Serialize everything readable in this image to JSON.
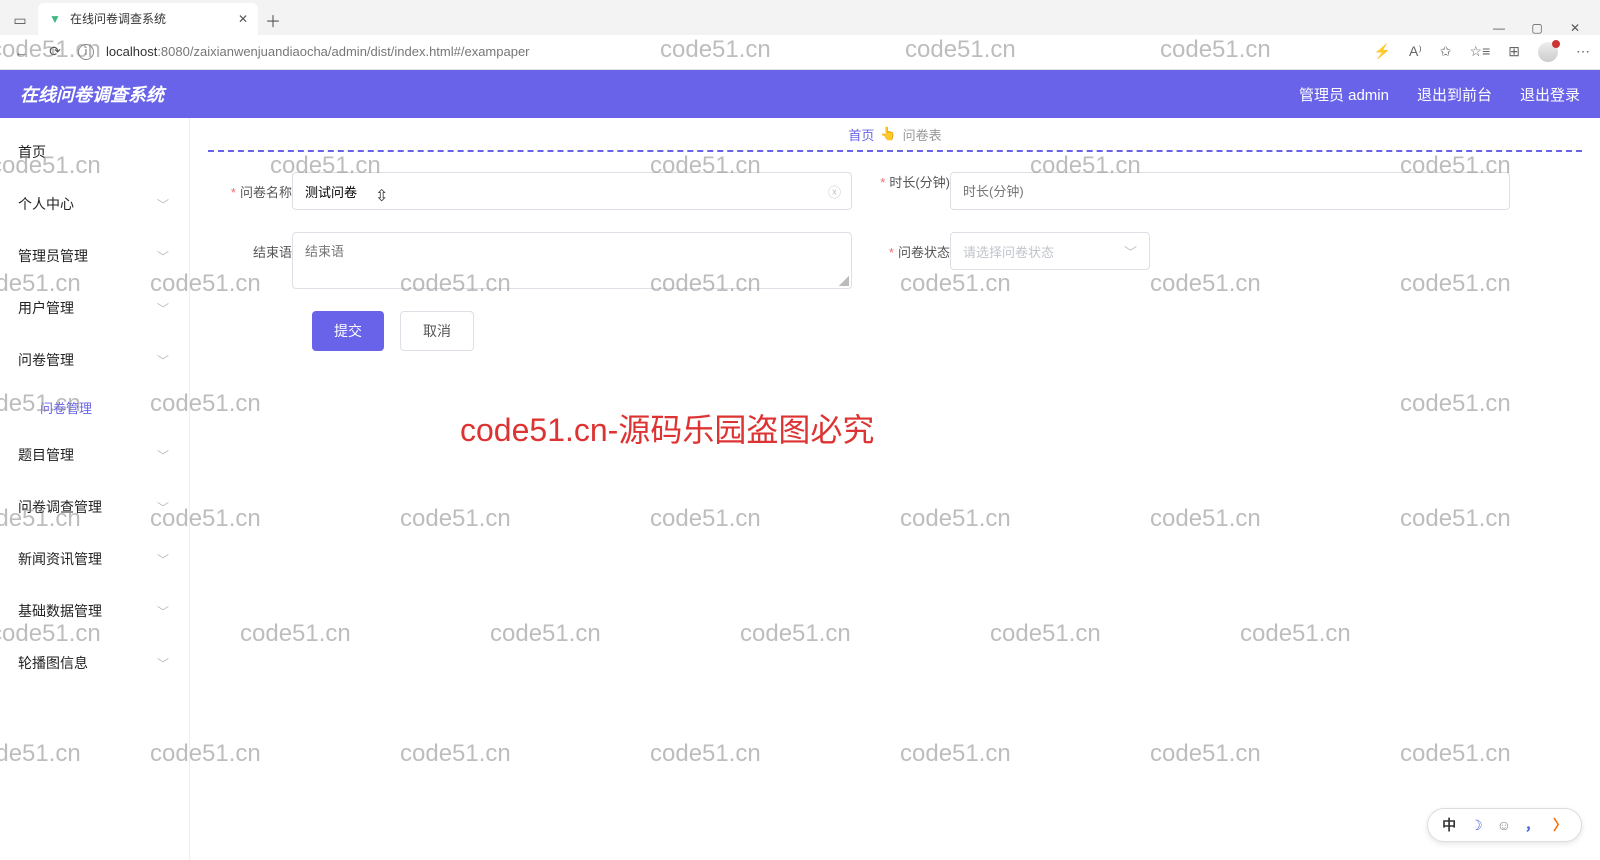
{
  "browser": {
    "tab_title": "在线问卷调查系统",
    "url_host": "localhost",
    "url_port": ":8080",
    "url_path": "/zaixianwenjuandiaocha/admin/dist/index.html#/exampaper"
  },
  "header": {
    "title": "在线问卷调查系统",
    "user": "管理员 admin",
    "to_front": "退出到前台",
    "logout": "退出登录"
  },
  "sidebar": {
    "items": [
      {
        "label": "首页",
        "expandable": false
      },
      {
        "label": "个人中心",
        "expandable": true
      },
      {
        "label": "管理员管理",
        "expandable": true
      },
      {
        "label": "用户管理",
        "expandable": true
      },
      {
        "label": "问卷管理",
        "expandable": true,
        "open": true,
        "children": [
          {
            "label": "问卷管理"
          }
        ]
      },
      {
        "label": "题目管理",
        "expandable": true
      },
      {
        "label": "问卷调查管理",
        "expandable": true
      },
      {
        "label": "新闻资讯管理",
        "expandable": true
      },
      {
        "label": "基础数据管理",
        "expandable": true
      },
      {
        "label": "轮播图信息",
        "expandable": true
      }
    ]
  },
  "breadcrumb": {
    "home": "首页",
    "emoji": "👆",
    "current": "问卷表"
  },
  "form": {
    "name_label": "问卷名称",
    "name_value": "测试问卷",
    "duration_label": "时长(分钟)",
    "duration_placeholder": "时长(分钟)",
    "end_label": "结束语",
    "end_placeholder": "结束语",
    "status_label": "问卷状态",
    "status_placeholder": "请选择问卷状态",
    "submit": "提交",
    "cancel": "取消"
  },
  "watermark": {
    "text": "code51.cn",
    "big": "code51.cn-源码乐园盗图必究"
  },
  "ime": {
    "lang": "中"
  }
}
